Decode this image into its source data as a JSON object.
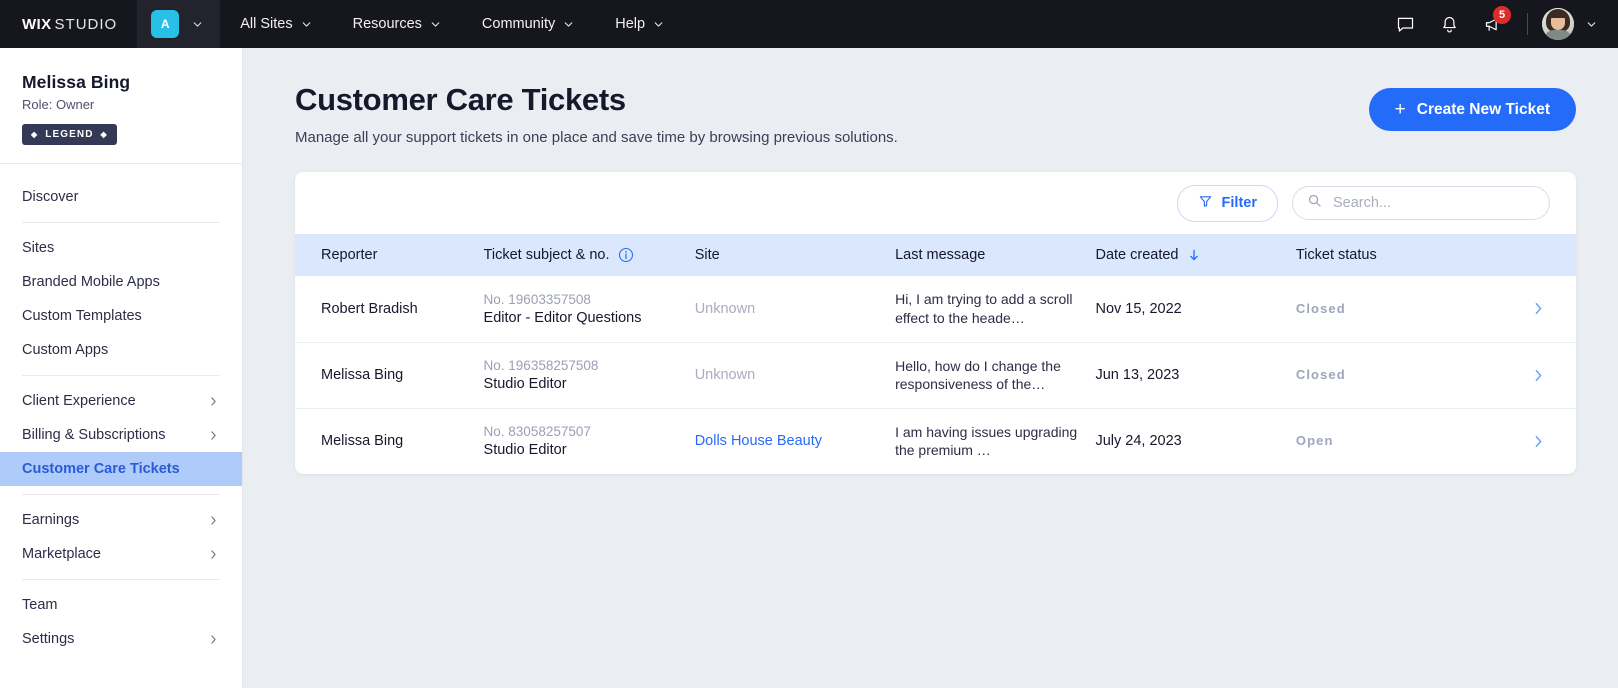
{
  "topbar": {
    "brand_wix": "WIX",
    "brand_studio": "STUDIO",
    "workspace_badge": "A",
    "nav": [
      {
        "label": "All Sites",
        "icon": "chevron-down-icon"
      },
      {
        "label": "Resources",
        "icon": "chevron-down-icon"
      },
      {
        "label": "Community",
        "icon": "chevron-down-icon"
      },
      {
        "label": "Help",
        "icon": "chevron-down-icon"
      }
    ],
    "icons": {
      "chat": "chat-icon",
      "bell": "bell-icon",
      "megaphone": "megaphone-icon"
    },
    "notification_count": "5",
    "accent_color": "#29c0e8",
    "badge_color": "#e02b2b"
  },
  "sidebar": {
    "profile": {
      "name": "Melissa Bing",
      "role": "Role: Owner",
      "badge_label": "LEGEND",
      "badge_diamond": "◆",
      "badge_color": "#343a55"
    },
    "groups": [
      {
        "items": [
          {
            "label": "Discover",
            "has_chevron": false,
            "active": false
          }
        ]
      },
      {
        "items": [
          {
            "label": "Sites",
            "has_chevron": false,
            "active": false
          },
          {
            "label": "Branded Mobile Apps",
            "has_chevron": false,
            "active": false
          },
          {
            "label": "Custom Templates",
            "has_chevron": false,
            "active": false
          },
          {
            "label": "Custom Apps",
            "has_chevron": false,
            "active": false
          }
        ]
      },
      {
        "items": [
          {
            "label": "Client Experience",
            "has_chevron": true,
            "active": false
          },
          {
            "label": "Billing & Subscriptions",
            "has_chevron": true,
            "active": false
          },
          {
            "label": "Customer Care Tickets",
            "has_chevron": false,
            "active": true
          }
        ]
      },
      {
        "items": [
          {
            "label": "Earnings",
            "has_chevron": true,
            "active": false
          },
          {
            "label": "Marketplace",
            "has_chevron": true,
            "active": false
          }
        ]
      },
      {
        "items": [
          {
            "label": "Team",
            "has_chevron": false,
            "active": false
          },
          {
            "label": "Settings",
            "has_chevron": true,
            "active": false
          }
        ]
      }
    ],
    "active_bg": "#aecbfa",
    "active_color": "#2a5bd7"
  },
  "main": {
    "title": "Customer Care Tickets",
    "subtitle": "Manage all your support tickets in one place and save time by browsing previous solutions.",
    "create_button": {
      "label": "Create New Ticket",
      "icon": "plus-icon",
      "color": "#256bfa"
    },
    "toolbar": {
      "filter_label": "Filter",
      "filter_icon": "funnel-icon",
      "search_placeholder": "Search...",
      "search_value": "",
      "search_icon": "search-icon"
    },
    "table": {
      "columns": [
        {
          "key": "reporter",
          "label": "Reporter",
          "info_icon": false,
          "sort_icon": false
        },
        {
          "key": "subject",
          "label": "Ticket subject & no.",
          "info_icon": true,
          "sort_icon": false
        },
        {
          "key": "site",
          "label": "Site",
          "info_icon": false,
          "sort_icon": false
        },
        {
          "key": "message",
          "label": "Last message",
          "info_icon": false,
          "sort_icon": false
        },
        {
          "key": "date",
          "label": "Date created",
          "info_icon": false,
          "sort_icon": true
        },
        {
          "key": "status",
          "label": "Ticket status",
          "info_icon": false,
          "sort_icon": false
        }
      ],
      "header_bg": "#dbe7fd",
      "sort_direction": "desc",
      "rows": [
        {
          "reporter": "Robert Bradish",
          "ticket_no": "No. 19603357508",
          "ticket_subject": "Editor - Editor Questions",
          "site": "Unknown",
          "site_is_link": false,
          "message": "Hi, I am trying to add a scroll effect to the heade…",
          "date": "Nov 15, 2022",
          "status": "Closed"
        },
        {
          "reporter": "Melissa Bing",
          "ticket_no": "No. 196358257508",
          "ticket_subject": "Studio Editor",
          "site": "Unknown",
          "site_is_link": false,
          "message": "Hello, how do I change the responsiveness of the…",
          "date": "Jun 13, 2023",
          "status": "Closed"
        },
        {
          "reporter": "Melissa Bing",
          "ticket_no": "No. 83058257507",
          "ticket_subject": "Studio Editor",
          "site": "Dolls House Beauty",
          "site_is_link": true,
          "message": "I am having issues upgrading the premium …",
          "date": "July 24, 2023",
          "status": "Open"
        }
      ]
    }
  }
}
